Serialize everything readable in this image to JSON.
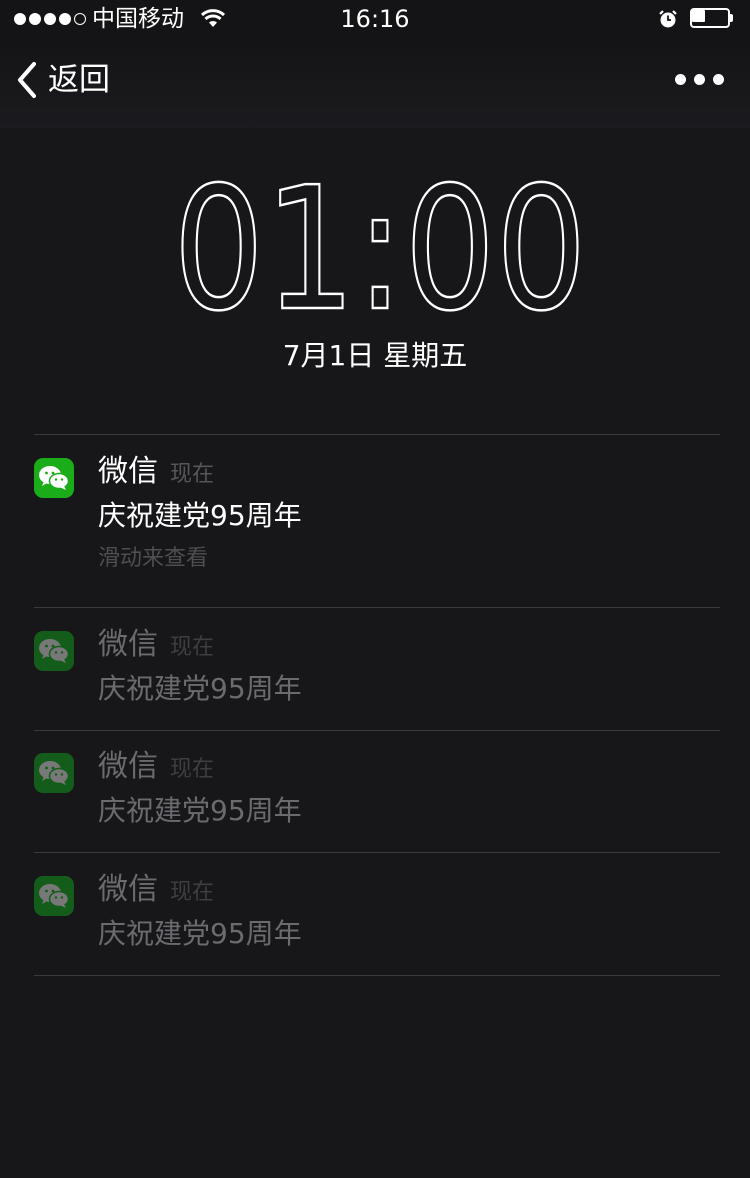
{
  "status_bar": {
    "signal_dots": [
      "full",
      "full",
      "full",
      "full",
      "empty"
    ],
    "carrier": "中国移动",
    "wifi_icon": "wifi-icon",
    "time": "16:16",
    "alarm_icon": "alarm-clock-icon",
    "battery_level": 0.35
  },
  "nav": {
    "back_label": "返回",
    "back_icon": "chevron-left-icon",
    "more_icon": "more-dots-icon"
  },
  "lock_screen": {
    "clock": "01:00",
    "date": "7月1日  星期五"
  },
  "notifications": [
    {
      "app": "微信",
      "time": "现在",
      "body": "庆祝建党95周年",
      "hint": "滑动来查看",
      "icon": "wechat-icon"
    },
    {
      "app": "微信",
      "time": "现在",
      "body": "庆祝建党95周年",
      "icon": "wechat-icon"
    },
    {
      "app": "微信",
      "time": "现在",
      "body": "庆祝建党95周年",
      "icon": "wechat-icon"
    },
    {
      "app": "微信",
      "time": "现在",
      "body": "庆祝建党95周年",
      "icon": "wechat-icon"
    }
  ],
  "colors": {
    "background": "#17171a",
    "wechat_green": "#1aad19",
    "wechat_green_dim": "#13691a",
    "divider": "#3a3a3e"
  }
}
